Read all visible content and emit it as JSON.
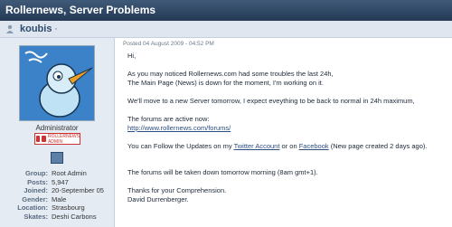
{
  "topic": {
    "title": "Rollernews, Server Problems"
  },
  "author": {
    "username": "koubis",
    "role": "Administrator",
    "badge_text": "ROLLERNEWS ADMIN",
    "stats": [
      {
        "label": "Group:",
        "value": "Root Admin"
      },
      {
        "label": "Posts:",
        "value": "5,947"
      },
      {
        "label": "Joined:",
        "value": "20-September 05"
      },
      {
        "label": "Gender:",
        "value": "Male"
      },
      {
        "label": "Location:",
        "value": "Strasbourg"
      },
      {
        "label": "Skates:",
        "value": "Deshi Carbons"
      }
    ]
  },
  "post": {
    "date": "Posted 04 August 2009 - 04:52 PM",
    "greeting": "Hi,",
    "p1_line1": "As you may noticed Rollernews.com had some troubles the last 24h,",
    "p1_line2": "The Main Page (News) is down for the moment, I'm working on it.",
    "p2": "We'll move to a new Server tomorrow, I expect eveything to be back to normal in 24h maximum,",
    "p3": "The forums are active now:",
    "forum_link": "http://www.rollernews.com/forums/",
    "p4_pre": "You can Follow the Updates on my ",
    "twitter_link": "Twitter Account",
    "p4_mid": " or on ",
    "facebook_link": "Facebook",
    "p4_post": " (New page created 2 days ago).",
    "p5": "The forums will be taken down tomorrow morning (8am gmt+1).",
    "p6_line1": "Thanks for your Comprehension.",
    "p6_line2": "David Durrenberger."
  },
  "colors": {
    "titlebar": "#2f4868",
    "userbar": "#dfe6ef",
    "sidebar": "#e4ebf3",
    "link": "#2c4d80"
  },
  "icons": [
    "user-icon",
    "pm-icon",
    "avatar-bird",
    "rollernews-logo-icon",
    "profile-card-icon"
  ]
}
